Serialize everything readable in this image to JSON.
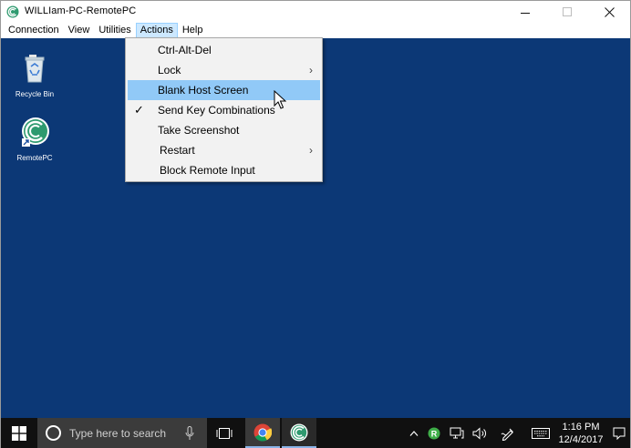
{
  "window": {
    "title": "WILLIam-PC-RemotePC",
    "controls": {
      "minimize": "minimize",
      "maximize": "maximize",
      "close": "close"
    }
  },
  "menubar": {
    "items": [
      {
        "label": "Connection"
      },
      {
        "label": "View"
      },
      {
        "label": "Utilities"
      },
      {
        "label": "Actions",
        "active": true
      },
      {
        "label": "Help"
      }
    ]
  },
  "desktop": {
    "background": "#0c3876",
    "icons": [
      {
        "label": "Recycle Bin",
        "icon": "recycle-bin-icon"
      },
      {
        "label": "RemotePC",
        "icon": "remotepc-icon"
      }
    ]
  },
  "actions_menu": {
    "items": [
      {
        "label": "Ctrl-Alt-Del"
      },
      {
        "label": "Lock",
        "submenu": true
      },
      {
        "label": "Blank Host Screen",
        "highlighted": true
      },
      {
        "label": "Send Key Combinations",
        "checked": true
      },
      {
        "label": "Take Screenshot"
      },
      {
        "label": "Restart",
        "submenu": true
      },
      {
        "label": "Block Remote Input"
      }
    ],
    "highlight_color": "#91c9f7"
  },
  "taskbar": {
    "search_placeholder": "Type here to search",
    "clock": {
      "time": "1:16 PM",
      "date": "12/4/2017"
    },
    "pinned": [
      "chrome-icon",
      "remotepc-icon"
    ]
  }
}
